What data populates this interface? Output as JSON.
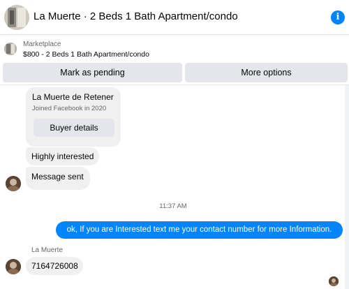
{
  "header": {
    "title": "La Muerte · 2 Beds 1 Bath Apartment/condo",
    "info_icon": "info-icon"
  },
  "listing": {
    "label": "Marketplace",
    "price_title": "$800 - 2 Beds 1 Bath Apartment/condo"
  },
  "actions": {
    "mark_pending": "Mark as pending",
    "more_options": "More options"
  },
  "buyer_card": {
    "name": "La Muerte de Retener",
    "joined": "Joined Facebook in 2020",
    "button": "Buyer details"
  },
  "messages": {
    "incoming_1": "Highly interested",
    "incoming_2": "Message sent",
    "timestamp": "11:37 AM",
    "outgoing_1": "ok, If you are Interested text me your contact number for more Information.",
    "sender_name": "La Muerte",
    "incoming_3": "7164726008"
  },
  "colors": {
    "accent": "#0084ff",
    "bubble_gray": "#f0f0f0",
    "button_gray": "#e4e6eb"
  }
}
